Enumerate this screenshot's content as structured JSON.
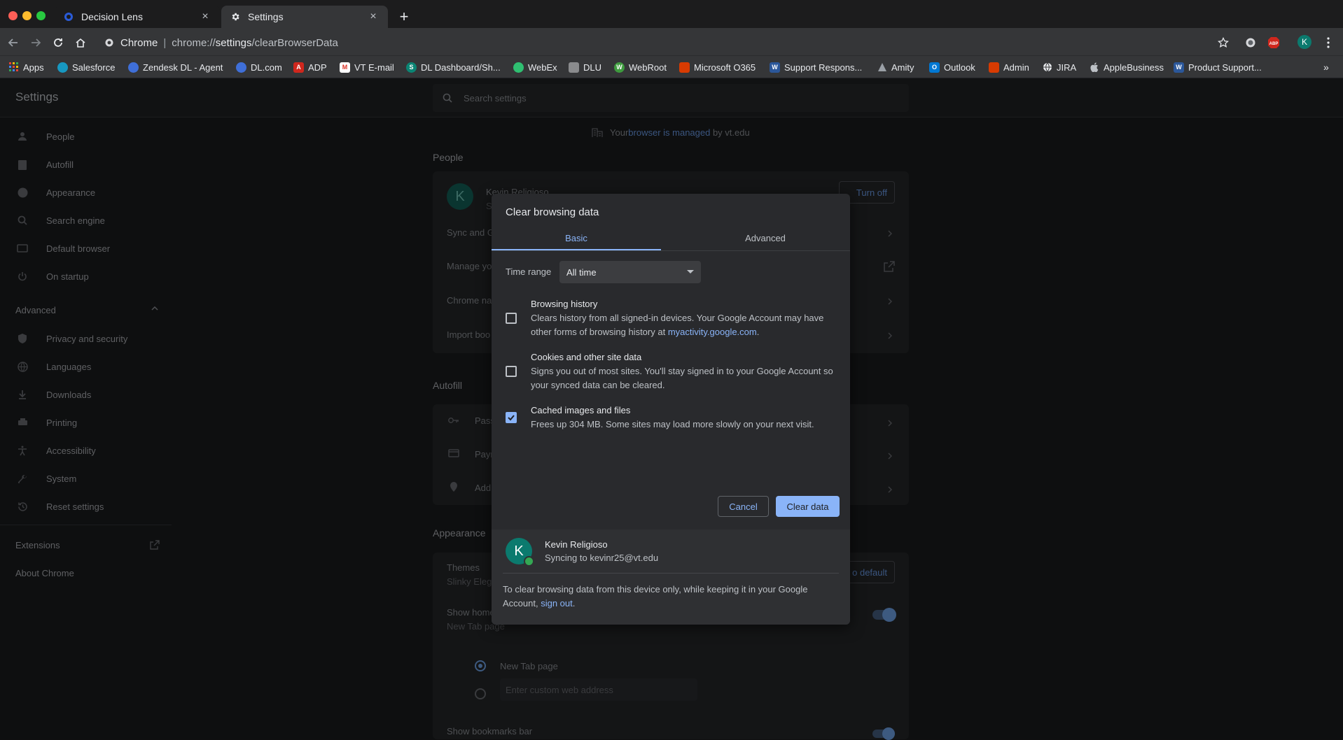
{
  "tabs": [
    {
      "title": "Decision Lens",
      "active": false
    },
    {
      "title": "Settings",
      "active": true
    }
  ],
  "toolbar": {
    "site_label": "Chrome",
    "url_prefix": "chrome://",
    "url_bold": "settings",
    "url_suffix": "/clearBrowserData",
    "profile_initial": "K"
  },
  "bookmarks": [
    {
      "label": "Apps",
      "icon": "apps-grid-icon",
      "color": "#e8eaed"
    },
    {
      "label": "Salesforce",
      "icon": "salesforce-icon",
      "color": "#1798c1"
    },
    {
      "label": "Zendesk DL - Agent",
      "icon": "zendesk-icon",
      "color": "#3f6fd8"
    },
    {
      "label": "DL.com",
      "icon": "dl-icon",
      "color": "#3f6fd8"
    },
    {
      "label": "ADP",
      "icon": "adp-icon",
      "color": "#d0271d"
    },
    {
      "label": "VT E-mail",
      "icon": "gmail-icon",
      "color": "#d93025"
    },
    {
      "label": "DL Dashboard/Sh...",
      "icon": "sharepoint-icon",
      "color": "#0b8574"
    },
    {
      "label": "WebEx",
      "icon": "webex-icon",
      "color": "#2fbf71"
    },
    {
      "label": "DLU",
      "icon": "dlu-icon",
      "color": "#8a8b8d"
    },
    {
      "label": "WebRoot",
      "icon": "webroot-icon",
      "color": "#3e9b3e"
    },
    {
      "label": "Microsoft O365",
      "icon": "office-icon",
      "color": "#d83b01"
    },
    {
      "label": "Support Respons...",
      "icon": "word-icon",
      "color": "#2b579a"
    },
    {
      "label": "Amity",
      "icon": "amity-icon",
      "color": "#9aa0a6"
    },
    {
      "label": "Outlook",
      "icon": "outlook-icon",
      "color": "#0078d4"
    },
    {
      "label": "Admin",
      "icon": "office-icon",
      "color": "#d83b01"
    },
    {
      "label": "JIRA",
      "icon": "globe-icon",
      "color": "#e8eaed"
    },
    {
      "label": "AppleBusiness",
      "icon": "apple-icon",
      "color": "#bdc1c6"
    },
    {
      "label": "Product Support...",
      "icon": "word-icon",
      "color": "#2b579a"
    }
  ],
  "settings": {
    "header_title": "Settings",
    "search_placeholder": "Search settings",
    "managed_prefix": "Your ",
    "managed_link": "browser is managed",
    "managed_suffix": " by vt.edu",
    "sidebar": [
      {
        "label": "People",
        "icon": "person-icon"
      },
      {
        "label": "Autofill",
        "icon": "clipboard-icon"
      },
      {
        "label": "Appearance",
        "icon": "palette-icon"
      },
      {
        "label": "Search engine",
        "icon": "search-icon"
      },
      {
        "label": "Default browser",
        "icon": "browser-icon"
      },
      {
        "label": "On startup",
        "icon": "power-icon"
      }
    ],
    "advanced_label": "Advanced",
    "advanced_items": [
      {
        "label": "Privacy and security",
        "icon": "shield-icon"
      },
      {
        "label": "Languages",
        "icon": "globe-icon"
      },
      {
        "label": "Downloads",
        "icon": "download-icon"
      },
      {
        "label": "Printing",
        "icon": "printer-icon"
      },
      {
        "label": "Accessibility",
        "icon": "accessibility-icon"
      },
      {
        "label": "System",
        "icon": "wrench-icon"
      },
      {
        "label": "Reset settings",
        "icon": "history-icon"
      }
    ],
    "extensions_label": "Extensions",
    "about_label": "About Chrome",
    "people_section": "People",
    "profile_name": "Kevin Religioso",
    "profile_sub": "S",
    "turn_off": "Turn off",
    "people_rows": [
      "Sync and G",
      "Manage yo",
      "Chrome na",
      "Import boo"
    ],
    "autofill_section": "Autofill",
    "autofill_rows": [
      "Pass",
      "Paym",
      "Add"
    ],
    "appearance_section": "Appearance",
    "themes_label": "Themes",
    "themes_sub": "Slinky Elega",
    "reset_default": "o default",
    "show_home": "Show home",
    "new_tab_sub": "New Tab page",
    "radio_new_tab": "New Tab page",
    "custom_address_placeholder": "Enter custom web address",
    "show_bookmarks": "Show bookmarks bar"
  },
  "dialog": {
    "title": "Clear browsing data",
    "tabs": [
      "Basic",
      "Advanced"
    ],
    "active_tab": "Basic",
    "time_range_label": "Time range",
    "time_range_value": "All time",
    "options": [
      {
        "title": "Browsing history",
        "desc": "Clears history from all signed-in devices. Your Google Account may have other forms of browsing history at ",
        "link": "myactivity.google.com",
        "desc_end": ".",
        "checked": false
      },
      {
        "title": "Cookies and other site data",
        "desc": "Signs you out of most sites. You'll stay signed in to your Google Account so your synced data can be cleared.",
        "checked": false
      },
      {
        "title": "Cached images and files",
        "desc": "Frees up 304 MB. Some sites may load more slowly on your next visit.",
        "checked": true
      }
    ],
    "cancel": "Cancel",
    "clear": "Clear data",
    "account_initial": "K",
    "account_name": "Kevin Religioso",
    "account_sync": "Syncing to kevinr25@vt.edu",
    "footer_text": "To clear browsing data from this device only, while keeping it in your Google Account, ",
    "footer_link": "sign out",
    "footer_end": "."
  },
  "colors": {
    "accent": "#8ab4f8",
    "dialog_bg": "#292a2d",
    "avatar_bg": "#0b7a6e"
  }
}
